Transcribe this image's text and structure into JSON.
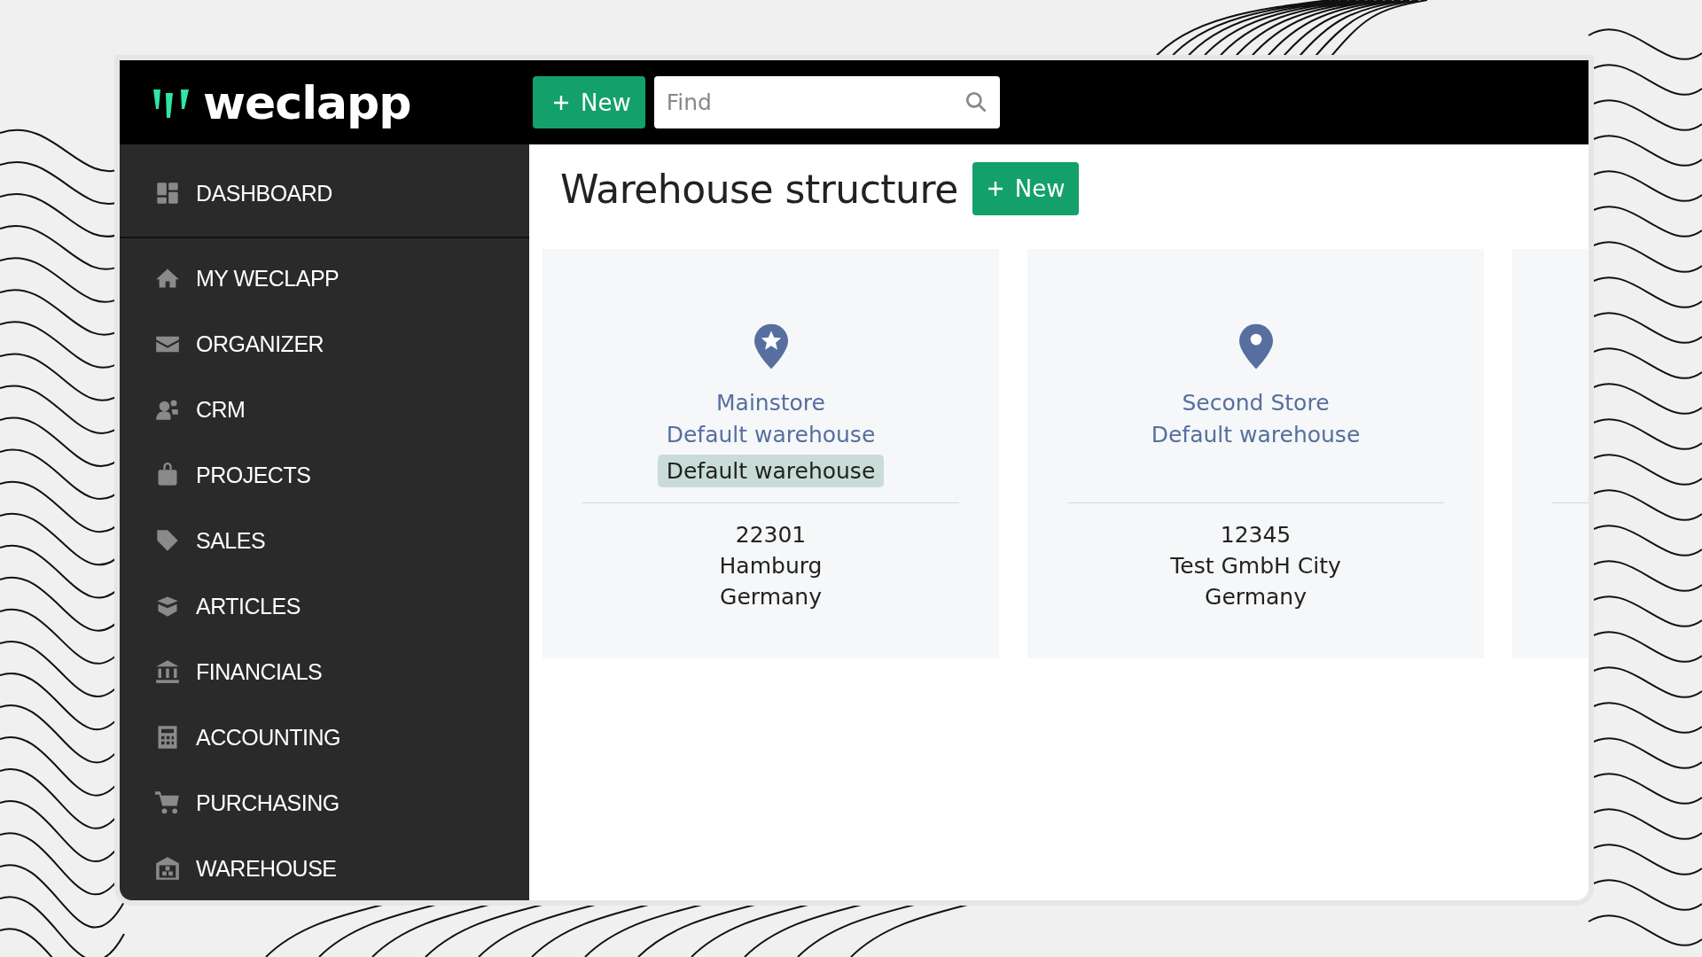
{
  "header": {
    "logo": "weclapp",
    "new_button": "New",
    "search": {
      "placeholder": "Find"
    }
  },
  "sidebar": {
    "top_item": {
      "label": "DASHBOARD"
    },
    "items": [
      {
        "label": "MY WECLAPP"
      },
      {
        "label": "ORGANIZER"
      },
      {
        "label": "CRM"
      },
      {
        "label": "PROJECTS"
      },
      {
        "label": "SALES"
      },
      {
        "label": "ARTICLES"
      },
      {
        "label": "FINANCIALS"
      },
      {
        "label": "ACCOUNTING"
      },
      {
        "label": "PURCHASING"
      },
      {
        "label": "WAREHOUSE"
      }
    ]
  },
  "page": {
    "title": "Warehouse structure",
    "new_button": "New"
  },
  "cards": [
    {
      "kind": "store",
      "default": true,
      "name": "Mainstore",
      "subtitle": "Default warehouse",
      "badge": "Default warehouse",
      "address": [
        "22301",
        "Hamburg",
        "Germany"
      ]
    },
    {
      "kind": "store",
      "default": false,
      "name": "Second Store",
      "subtitle": "Default warehouse",
      "address": [
        "12345",
        "Test GmbH City",
        "Germany"
      ]
    },
    {
      "kind": "cut_off"
    }
  ]
}
